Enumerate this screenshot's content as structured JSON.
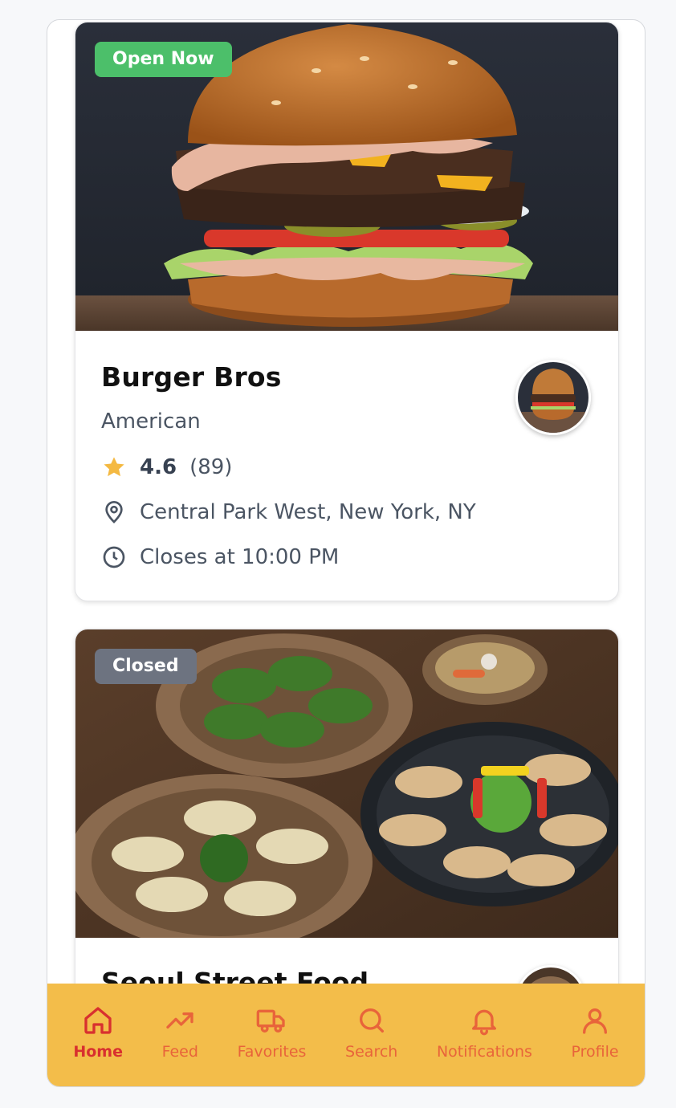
{
  "colors": {
    "accent": "#f3bd4a",
    "nav_icon": "#e8643a",
    "nav_active": "#d8302f",
    "open_badge": "#4cbf6a",
    "closed_badge": "#6d7380",
    "star": "#f4b942"
  },
  "restaurants": [
    {
      "status": "Open Now",
      "name": "Burger Bros",
      "cuisine": "American",
      "rating": "4.6",
      "reviews": "(89)",
      "address": "Central Park West, New York, NY",
      "hours": "Closes at 10:00 PM",
      "image": "burger-photo"
    },
    {
      "status": "Closed",
      "name": "Seoul Street Food",
      "image": "dumplings-photo"
    }
  ],
  "nav": {
    "items": [
      {
        "label": "Home",
        "icon": "home-icon",
        "active": true
      },
      {
        "label": "Feed",
        "icon": "trending-icon"
      },
      {
        "label": "Favorites",
        "icon": "truck-icon"
      },
      {
        "label": "Search",
        "icon": "search-icon"
      },
      {
        "label": "Notifications",
        "icon": "bell-icon"
      },
      {
        "label": "Profile",
        "icon": "user-icon"
      }
    ]
  }
}
